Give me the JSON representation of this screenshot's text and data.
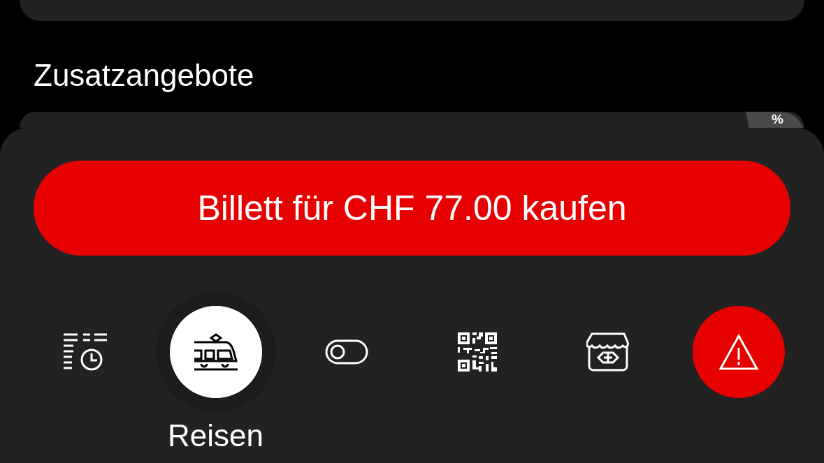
{
  "section_title": "Zusatzangebote",
  "offer_card": {
    "badge": "%"
  },
  "buy_button": {
    "label": "Billett für CHF 77.00 kaufen"
  },
  "tab_bar": [
    {
      "kind": "tab",
      "selected": false
    },
    {
      "kind": "tab",
      "selected": true,
      "label": "Reisen"
    },
    {
      "kind": "tab",
      "selected": false
    },
    {
      "kind": "tab",
      "selected": false
    },
    {
      "kind": "tab",
      "selected": false
    },
    {
      "kind": "alert",
      "selected": false
    }
  ]
}
